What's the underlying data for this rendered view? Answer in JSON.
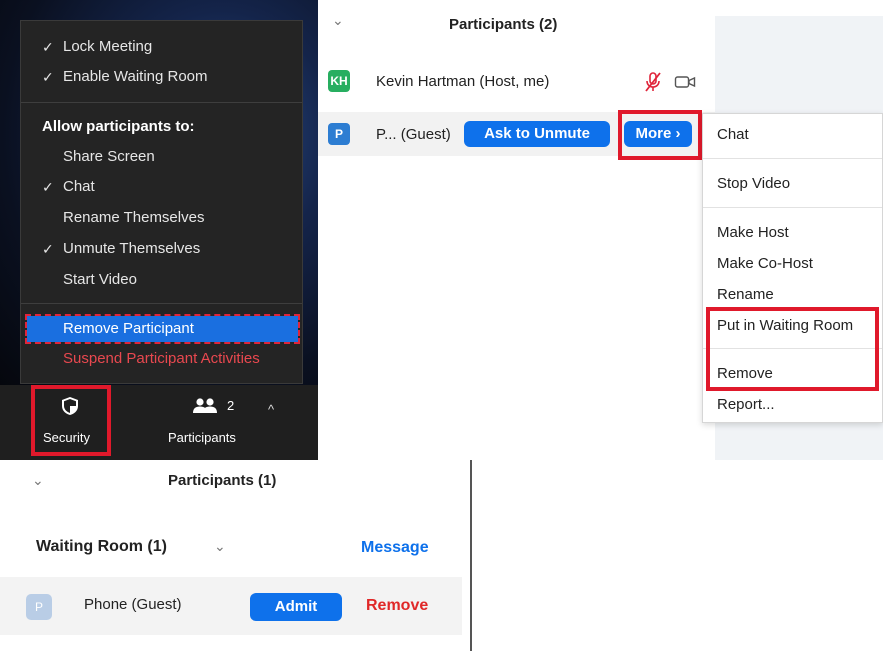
{
  "security_menu": {
    "lock_meeting": {
      "label": "Lock Meeting",
      "checked": true
    },
    "enable_waiting_room": {
      "label": "Enable Waiting Room",
      "checked": true
    },
    "allow_header": "Allow participants to:",
    "allow_items": [
      {
        "label": "Share Screen",
        "checked": false
      },
      {
        "label": "Chat",
        "checked": true
      },
      {
        "label": "Rename Themselves",
        "checked": false
      },
      {
        "label": "Unmute Themselves",
        "checked": true
      },
      {
        "label": "Start Video",
        "checked": false
      }
    ],
    "remove_participant": "Remove Participant",
    "suspend_activities": "Suspend Participant Activities",
    "check_glyph": "✓"
  },
  "toolbar": {
    "security_label": "Security",
    "participants_label": "Participants",
    "participants_count": "2",
    "caret": "^"
  },
  "participants_panel": {
    "title": "Participants (2)",
    "collapse_glyph": "⌄",
    "rows": [
      {
        "initials": "KH",
        "name": "Kevin Hartman (Host, me)",
        "avatar_color": "#27ae60"
      },
      {
        "initials": "P",
        "name": "P... (Guest)",
        "avatar_color": "#2d7dd2"
      }
    ],
    "ask_to_unmute": "Ask to Unmute",
    "more_label": "More ›"
  },
  "context_menu": {
    "items": [
      "Chat",
      "Stop Video",
      "Make Host",
      "Make Co-Host",
      "Rename",
      "Put in Waiting Room",
      "Remove",
      "Report..."
    ]
  },
  "waiting_panel": {
    "title": "Participants (1)",
    "collapse_glyph": "⌄",
    "section_label": "Waiting Room (1)",
    "section_chevron": "⌄",
    "message_label": "Message",
    "row": {
      "initial": "P",
      "name": "Phone (Guest)",
      "avatar_color": "#b9cde6"
    },
    "admit_label": "Admit",
    "remove_label": "Remove"
  },
  "colors": {
    "accent_blue": "#0e71eb",
    "highlight_red": "#e0192b",
    "danger_red": "#e02828"
  },
  "icons": [
    "check-icon",
    "shield-icon",
    "people-icon",
    "caret-up-icon",
    "chevron-down-icon",
    "mic-muted-icon",
    "camera-icon"
  ]
}
